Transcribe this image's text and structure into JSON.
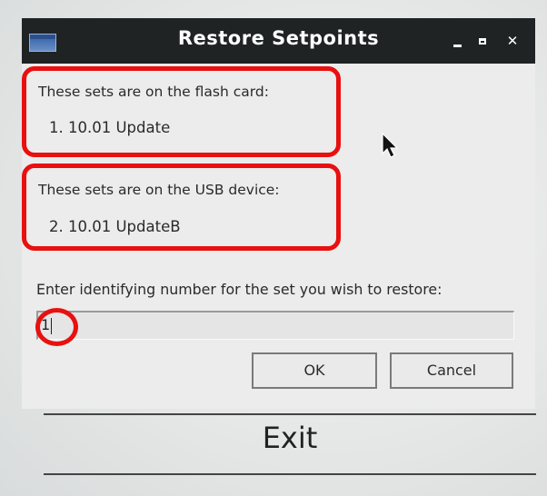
{
  "window": {
    "title": "Restore Setpoints"
  },
  "flash_group": {
    "label": "These sets are on the flash card:",
    "items": [
      "1.  10.01 Update"
    ]
  },
  "usb_group": {
    "label": "These sets are on the USB device:",
    "items": [
      "2.  10.01 UpdateB"
    ]
  },
  "prompt": {
    "label": "Enter identifying number for the set you wish to restore:",
    "input_value": "1"
  },
  "buttons": {
    "ok": "OK",
    "cancel": "Cancel"
  },
  "exit": {
    "label": "Exit"
  },
  "icons": [
    "window-icon",
    "minimize-icon",
    "maximize-icon",
    "close-icon",
    "mouse-cursor-icon"
  ],
  "colors": {
    "titlebar": "#1f2324",
    "highlight": "#e81010"
  }
}
